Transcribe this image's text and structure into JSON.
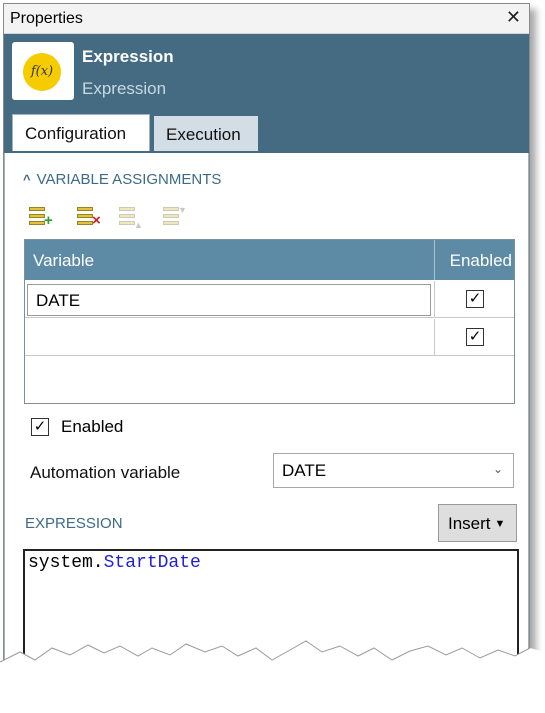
{
  "titlebar": {
    "title": "Properties",
    "close_glyph": "✕"
  },
  "header": {
    "icon_text": "f(x)",
    "title": "Expression",
    "subtitle": "Expression",
    "icon_color": "#f5cc00",
    "accent": "#456b82"
  },
  "tabs": [
    {
      "label": "Configuration",
      "active": true
    },
    {
      "label": "Execution",
      "active": false
    }
  ],
  "section": {
    "title": "VARIABLE ASSIGNMENTS",
    "chevron": "^"
  },
  "toolbar": [
    {
      "icon": "add-row-icon",
      "enabled": true
    },
    {
      "icon": "delete-row-icon",
      "enabled": true
    },
    {
      "icon": "move-up-icon",
      "enabled": false
    },
    {
      "icon": "move-down-icon",
      "enabled": false
    }
  ],
  "grid": {
    "columns": [
      "Variable",
      "Enabled"
    ],
    "rows": [
      {
        "variable": "DATE",
        "enabled": true
      },
      {
        "variable": "",
        "enabled": true
      }
    ]
  },
  "enabled_checkbox": {
    "label": "Enabled",
    "checked": true
  },
  "automation_variable": {
    "label": "Automation variable",
    "value": "DATE"
  },
  "expression": {
    "label": "EXPRESSION",
    "insert_label": "Insert",
    "code_object": "system.",
    "code_member": "StartDate"
  }
}
